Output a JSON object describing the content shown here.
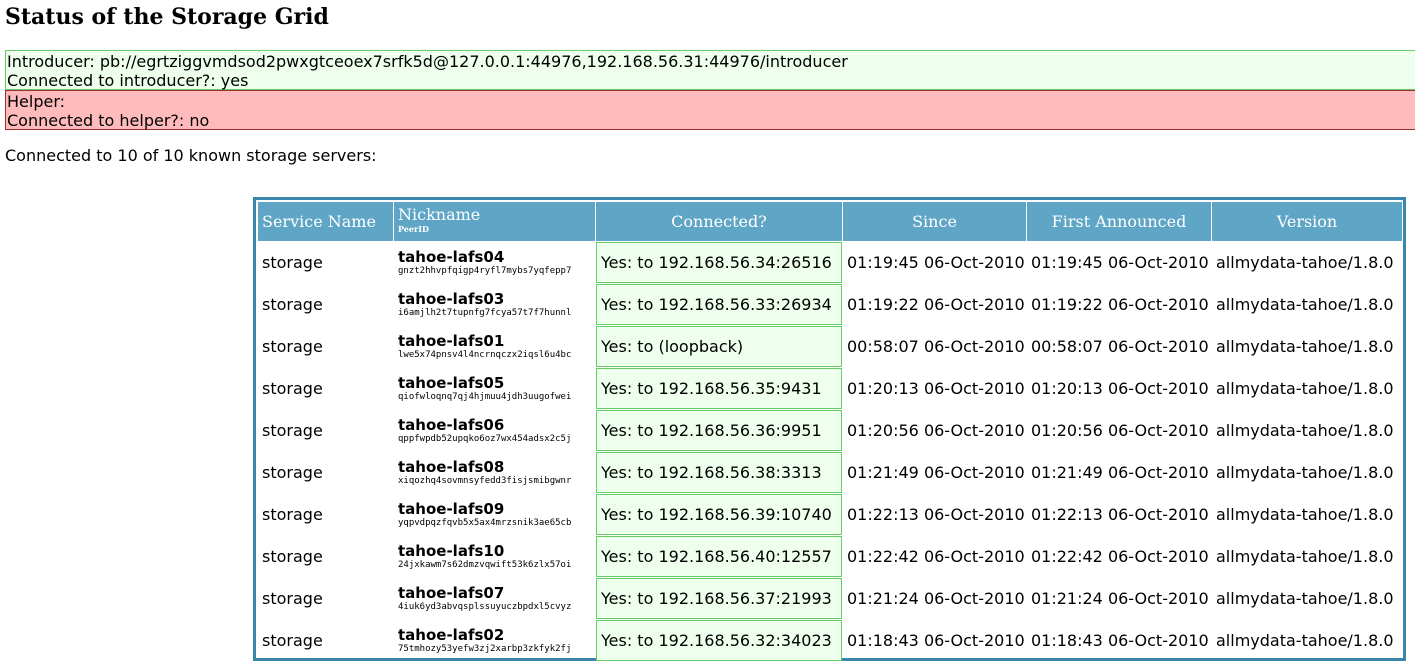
{
  "page": {
    "title": "Status of the Storage Grid"
  },
  "introducer": {
    "furl_line": "Introducer: pb://egrtziggvmdsod2pwxgtceoex7srfk5d@127.0.0.1:44976,192.168.56.31:44976/introducer",
    "connected_line": "Connected to introducer?: yes"
  },
  "helper": {
    "label_line": "Helper:",
    "connected_line": "Connected to helper?: no"
  },
  "summary": "Connected to 10 of 10 known storage servers:",
  "table": {
    "headers": {
      "service_name": "Service Name",
      "nickname": "Nickname",
      "peerid": "PeerID",
      "connected": "Connected?",
      "since": "Since",
      "first_announced": "First Announced",
      "version": "Version"
    },
    "rows": [
      {
        "service": "storage",
        "nickname": "tahoe-lafs04",
        "peerid": "gnzt2hhvpfqigp4ryfl7mybs7yqfepp7",
        "connected": "Yes: to 192.168.56.34:26516",
        "since": "01:19:45 06-Oct-2010",
        "announced": "01:19:45 06-Oct-2010",
        "version": "allmydata-tahoe/1.8.0"
      },
      {
        "service": "storage",
        "nickname": "tahoe-lafs03",
        "peerid": "i6amjlh2t7tupnfg7fcya57t7f7hunnl",
        "connected": "Yes: to 192.168.56.33:26934",
        "since": "01:19:22 06-Oct-2010",
        "announced": "01:19:22 06-Oct-2010",
        "version": "allmydata-tahoe/1.8.0"
      },
      {
        "service": "storage",
        "nickname": "tahoe-lafs01",
        "peerid": "lwe5x74pnsv4l4ncrnqczx2iqsl6u4bc",
        "connected": "Yes: to (loopback)",
        "since": "00:58:07 06-Oct-2010",
        "announced": "00:58:07 06-Oct-2010",
        "version": "allmydata-tahoe/1.8.0"
      },
      {
        "service": "storage",
        "nickname": "tahoe-lafs05",
        "peerid": "qiofwloqnq7qj4hjmuu4jdh3uugofwei",
        "connected": "Yes: to 192.168.56.35:9431",
        "since": "01:20:13 06-Oct-2010",
        "announced": "01:20:13 06-Oct-2010",
        "version": "allmydata-tahoe/1.8.0"
      },
      {
        "service": "storage",
        "nickname": "tahoe-lafs06",
        "peerid": "qppfwpdb52upqko6oz7wx454adsx2c5j",
        "connected": "Yes: to 192.168.56.36:9951",
        "since": "01:20:56 06-Oct-2010",
        "announced": "01:20:56 06-Oct-2010",
        "version": "allmydata-tahoe/1.8.0"
      },
      {
        "service": "storage",
        "nickname": "tahoe-lafs08",
        "peerid": "xiqozhq4sovmnsyfedd3fisjsmibgwnr",
        "connected": "Yes: to 192.168.56.38:3313",
        "since": "01:21:49 06-Oct-2010",
        "announced": "01:21:49 06-Oct-2010",
        "version": "allmydata-tahoe/1.8.0"
      },
      {
        "service": "storage",
        "nickname": "tahoe-lafs09",
        "peerid": "yqpvdpqzfqvb5x5ax4mrzsnik3ae65cb",
        "connected": "Yes: to 192.168.56.39:10740",
        "since": "01:22:13 06-Oct-2010",
        "announced": "01:22:13 06-Oct-2010",
        "version": "allmydata-tahoe/1.8.0"
      },
      {
        "service": "storage",
        "nickname": "tahoe-lafs10",
        "peerid": "24jxkawm7s62dmzvqwift53k6zlx57oi",
        "connected": "Yes: to 192.168.56.40:12557",
        "since": "01:22:42 06-Oct-2010",
        "announced": "01:22:42 06-Oct-2010",
        "version": "allmydata-tahoe/1.8.0"
      },
      {
        "service": "storage",
        "nickname": "tahoe-lafs07",
        "peerid": "4iuk6yd3abvqsplssuyuczbpdxl5cvyz",
        "connected": "Yes: to 192.168.56.37:21993",
        "since": "01:21:24 06-Oct-2010",
        "announced": "01:21:24 06-Oct-2010",
        "version": "allmydata-tahoe/1.8.0"
      },
      {
        "service": "storage",
        "nickname": "tahoe-lafs02",
        "peerid": "75tmhozy53yefw3zj2xarbp3zkfyk2fj",
        "connected": "Yes: to 192.168.56.32:34023",
        "since": "01:18:43 06-Oct-2010",
        "announced": "01:18:43 06-Oct-2010",
        "version": "allmydata-tahoe/1.8.0"
      }
    ]
  },
  "colors": {
    "header_bg": "#5fa5c6",
    "table_border": "#3a86ad",
    "connected_bg": "#eeffee",
    "connected_border": "#66cc66",
    "helper_bg": "#ffbbbb"
  }
}
